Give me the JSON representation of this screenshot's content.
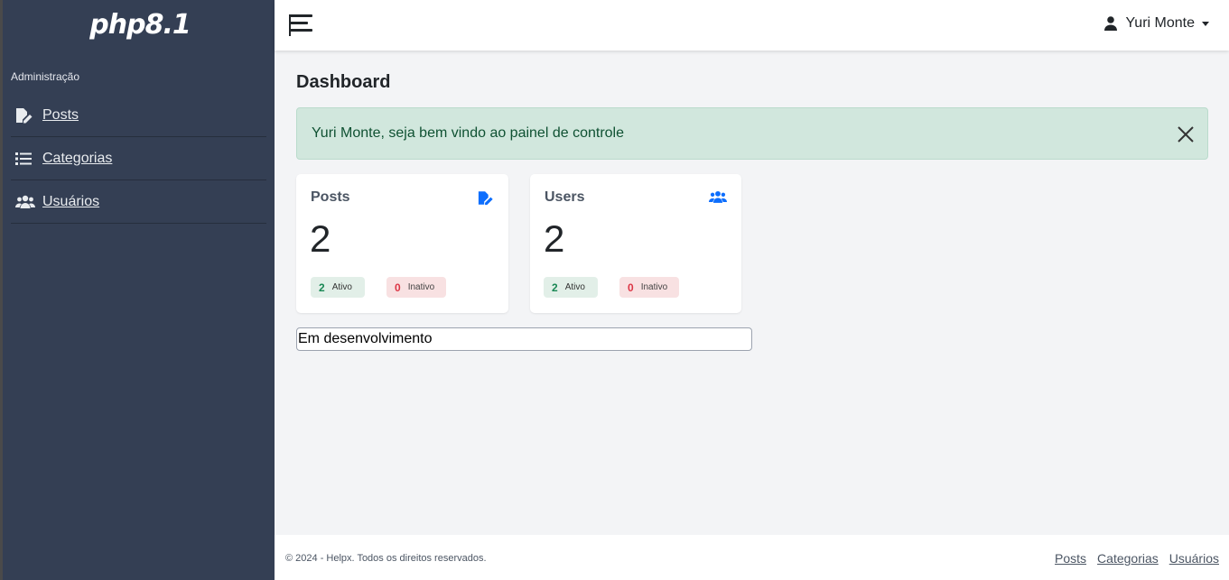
{
  "sidebar": {
    "logo_text": "php8.1",
    "section_label": "Administração",
    "items": [
      {
        "label": "Posts",
        "icon": "file-pen-icon"
      },
      {
        "label": "Categorias",
        "icon": "list-icon"
      },
      {
        "label": "Usuários",
        "icon": "users-icon"
      }
    ]
  },
  "topbar": {
    "user_name": "Yuri Monte",
    "user_icon": "user-icon",
    "menu_icon": "hamburger-icon"
  },
  "main": {
    "title": "Dashboard",
    "alert_message": "Yuri Monte, seja bem vindo ao painel de controle",
    "cards": [
      {
        "title": "Posts",
        "count": "2",
        "active_count": "2",
        "active_label": "Ativo",
        "inactive_count": "0",
        "inactive_label": "Inativo",
        "icon": "file-pen-icon"
      },
      {
        "title": "Users",
        "count": "2",
        "active_count": "2",
        "active_label": "Ativo",
        "inactive_count": "0",
        "inactive_label": "Inativo",
        "icon": "users-icon"
      }
    ],
    "dev_notice": "Em desenvolvimento"
  },
  "footer": {
    "copyright": "© 2024 - Helpx. Todos os direitos reservados.",
    "links": [
      "Posts",
      "Categorias",
      "Usuários"
    ]
  },
  "colors": {
    "sidebar_bg": "#343f54",
    "accent": "#0d6efd",
    "alert_bg": "#d1e7dd",
    "alert_text": "#0f5132",
    "success": "#198754",
    "danger": "#dc3545"
  }
}
